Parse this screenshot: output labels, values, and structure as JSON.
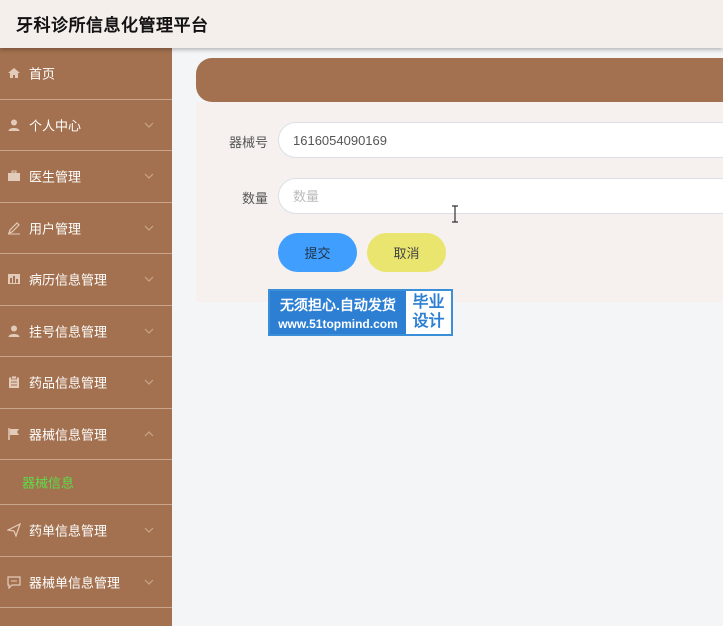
{
  "app": {
    "title": "牙科诊所信息化管理平台"
  },
  "sidebar": {
    "items": [
      {
        "label": "首页",
        "icon": "home-icon",
        "expandable": false
      },
      {
        "label": "个人中心",
        "icon": "user-icon",
        "expandable": true
      },
      {
        "label": "医生管理",
        "icon": "briefcase-icon",
        "expandable": true
      },
      {
        "label": "用户管理",
        "icon": "pen-icon",
        "expandable": true
      },
      {
        "label": "病历信息管理",
        "icon": "chart-icon",
        "expandable": true
      },
      {
        "label": "挂号信息管理",
        "icon": "user-icon",
        "expandable": true
      },
      {
        "label": "药品信息管理",
        "icon": "clipboard-icon",
        "expandable": true
      },
      {
        "label": "器械信息管理",
        "icon": "flag-icon",
        "expandable": true,
        "expanded": true
      },
      {
        "label": "药单信息管理",
        "icon": "send-icon",
        "expandable": true
      },
      {
        "label": "器械单信息管理",
        "icon": "chat-icon",
        "expandable": true
      }
    ],
    "active_subitem": {
      "label": "器械信息",
      "color": "#5fdc4a"
    }
  },
  "form": {
    "equipment_no": {
      "label": "器械号",
      "value": "1616054090169"
    },
    "quantity": {
      "label": "数量",
      "value": "",
      "placeholder": "数量"
    },
    "submit_label": "提交",
    "cancel_label": "取消"
  },
  "watermark": {
    "line1": "无须担心.自动发货",
    "line2": "www.51topmind.com",
    "badge_line1": "毕业",
    "badge_line2": "设计"
  },
  "colors": {
    "sidebar": "#a3714f",
    "accent_submit": "#409eff",
    "accent_cancel": "#e9e56f",
    "active_sub": "#5fdc4a"
  }
}
